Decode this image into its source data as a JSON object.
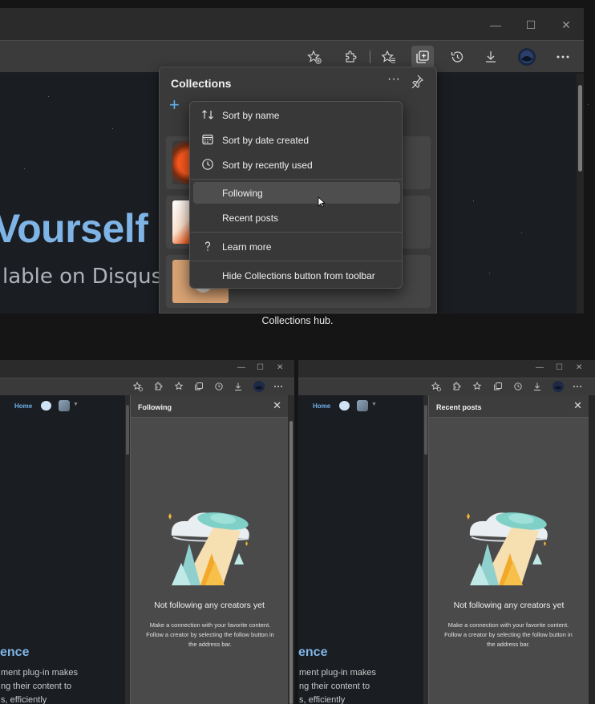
{
  "top_window": {
    "window_controls": {
      "minimize": "—",
      "maximize": "☐",
      "close": "✕"
    },
    "toolbar_icons": [
      "favorites-add-icon",
      "extensions-icon",
      "favorites-icon",
      "collections-icon",
      "history-icon",
      "downloads-icon",
      "profile-avatar",
      "more-icon"
    ],
    "page": {
      "hero_title": "Vourself",
      "hero_subtitle": "lable on Disqus"
    },
    "collections": {
      "title": "Collections",
      "more": "···",
      "add": "+"
    },
    "menu": {
      "items": [
        {
          "label": "Sort by name",
          "icon": "sort-icon"
        },
        {
          "label": "Sort by date created",
          "icon": "calendar-icon"
        },
        {
          "label": "Sort by recently used",
          "icon": "clock-icon"
        },
        {
          "label": "Following",
          "icon": ""
        },
        {
          "label": "Recent posts",
          "icon": ""
        },
        {
          "label": "Learn more",
          "icon": "question-icon"
        },
        {
          "label": "Hide Collections button from toolbar",
          "icon": ""
        }
      ],
      "hovered": "Following"
    }
  },
  "caption": "Collections hub.",
  "bottom_left": {
    "window_controls": {
      "minimize": "—",
      "maximize": "☐",
      "close": "✕"
    },
    "page": {
      "home": "Home",
      "heading_fragment": "ence",
      "body_lines": [
        "ment plug-in makes",
        "ng their content to",
        "s, efficiently"
      ]
    },
    "panel": {
      "title": "Following",
      "close": "✕",
      "empty_title": "Not following any creators yet",
      "empty_body": "Make a connection with your favorite content. Follow a creator by selecting the follow button in the address bar."
    }
  },
  "bottom_right": {
    "window_controls": {
      "minimize": "—",
      "maximize": "☐",
      "close": "✕"
    },
    "page": {
      "home": "Home",
      "heading_fragment": "ence",
      "body_lines": [
        "ment plug-in makes",
        "ng their content to",
        "s, efficiently"
      ]
    },
    "panel": {
      "title": "Recent posts",
      "close": "✕",
      "empty_title": "Not following any creators yet",
      "empty_body": "Make a connection with your favorite content. Follow a creator by selecting the follow button in the address bar."
    }
  },
  "colors": {
    "accent": "#7fb4e6",
    "hover": "#4e4e4e",
    "panel": "#3a3a3a"
  }
}
